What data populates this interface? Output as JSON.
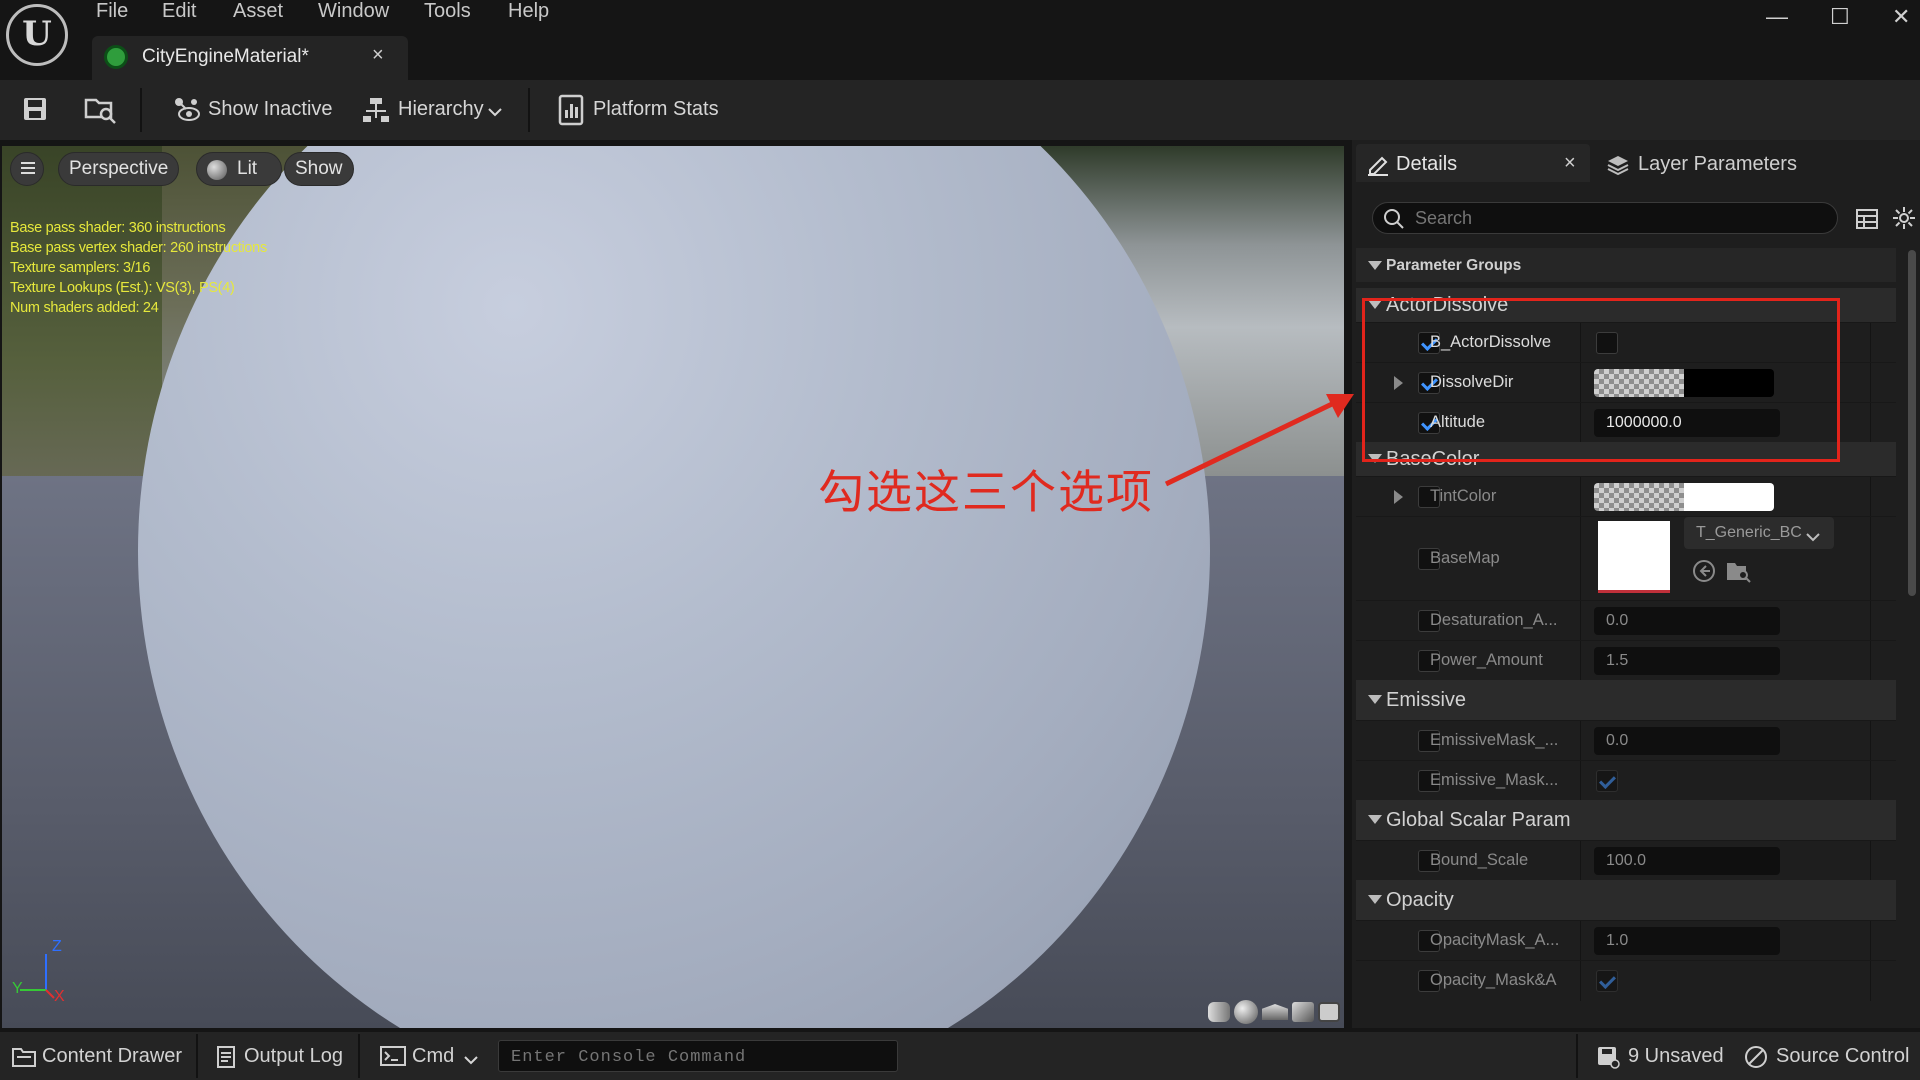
{
  "app": {
    "logo": "U",
    "tab_title": "CityEngineMaterial*",
    "tab_close": "×"
  },
  "menu": [
    "File",
    "Edit",
    "Asset",
    "Window",
    "Tools",
    "Help"
  ],
  "window_controls": {
    "minimize": "—",
    "maximize": "☐",
    "close": "✕"
  },
  "toolbar": {
    "show_inactive": "Show Inactive",
    "hierarchy": "Hierarchy",
    "platform_stats": "Platform Stats"
  },
  "viewport": {
    "perspective": "Perspective",
    "lit": "Lit",
    "show": "Show",
    "stats": [
      "Base pass shader: 360 instructions",
      "Base pass vertex shader: 260 instructions",
      "Texture samplers: 3/16",
      "Texture Lookups (Est.): VS(3), PS(4)",
      "Num shaders added: 24"
    ],
    "axes": {
      "z": "Z",
      "y": "Y",
      "x": "X"
    },
    "annotation": "勾选这三个选项",
    "colors": {
      "annotation": "#e02a1f",
      "stats": "#e6e83c"
    }
  },
  "details": {
    "tab_details": "Details",
    "tab_close": "×",
    "tab_layer": "Layer Parameters",
    "search_placeholder": "Search",
    "parameter_groups": "Parameter Groups",
    "groups": {
      "actor_dissolve": "ActorDissolve",
      "base_color": "BaseColor",
      "emissive": "Emissive",
      "global_scalar": "Global Scalar Param",
      "opacity": "Opacity"
    },
    "rows": {
      "b_actor": {
        "label": "B_ActorDissolve",
        "enabled": true,
        "value_checked": false
      },
      "dissolve_dir": {
        "label": "DissolveDir",
        "enabled": true
      },
      "altitude": {
        "label": "Altitude",
        "enabled": true,
        "value": "1000000.0"
      },
      "tint": {
        "label": "TintColor",
        "enabled": false
      },
      "basemap": {
        "label": "BaseMap",
        "enabled": false,
        "texture": "T_Generic_BC"
      },
      "desat": {
        "label": "Desaturation_A...",
        "enabled": false,
        "value": "0.0"
      },
      "power": {
        "label": "Power_Amount",
        "enabled": false,
        "value": "1.5"
      },
      "emissive_mask_a": {
        "label": "EmissiveMask_...",
        "enabled": false,
        "value": "0.0"
      },
      "emissive_mask_b": {
        "label": "Emissive_Mask...",
        "enabled": false,
        "value_checked": true
      },
      "bound_scale": {
        "label": "Bound_Scale",
        "enabled": false,
        "value": "100.0"
      },
      "opacity_mask_a": {
        "label": "OpacityMask_A...",
        "enabled": false,
        "value": "1.0"
      },
      "opacity_mask_b": {
        "label": "Opacity_Mask&A",
        "enabled": false,
        "value_checked": true
      }
    },
    "highlight_color": "#e3241b"
  },
  "statusbar": {
    "content_drawer": "Content Drawer",
    "output_log": "Output Log",
    "cmd": "Cmd",
    "console_placeholder": "Enter Console Command",
    "unsaved": "9 Unsaved",
    "source_control": "Source Control"
  }
}
